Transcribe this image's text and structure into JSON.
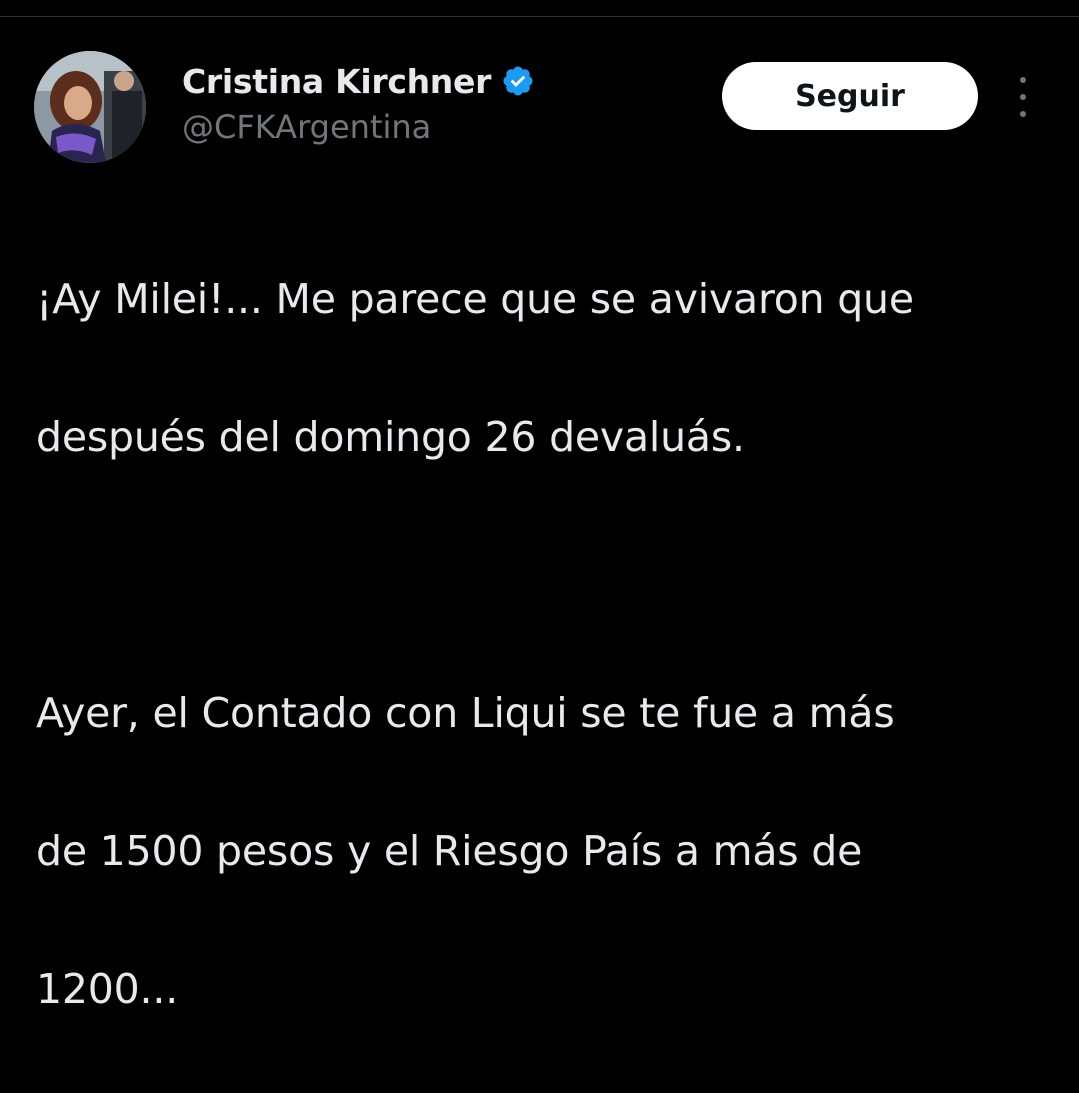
{
  "tweet": {
    "author": {
      "display_name": "Cristina Kirchner",
      "handle": "@CFKArgentina",
      "verified": true,
      "verified_color": "#1d9bf0",
      "avatar_icon": "profile-photo"
    },
    "follow_label": "Seguir",
    "more_icon": "more-options-icon",
    "text": {
      "lines_para1": [
        "¡Ay Milei!... Me parece que se avivaron que",
        "después del domingo 26 devaluás."
      ],
      "lines_para2": [
        "Ayer, el Contado con Liqui se te fue a más",
        "de 1500 pesos y el Riesgo País a más de",
        "1200..."
      ]
    }
  },
  "theme": {
    "background": "#000000",
    "text_primary": "#e7e9ea",
    "text_secondary": "#71767b",
    "button_bg": "#ffffff",
    "button_text": "#0f1419"
  }
}
